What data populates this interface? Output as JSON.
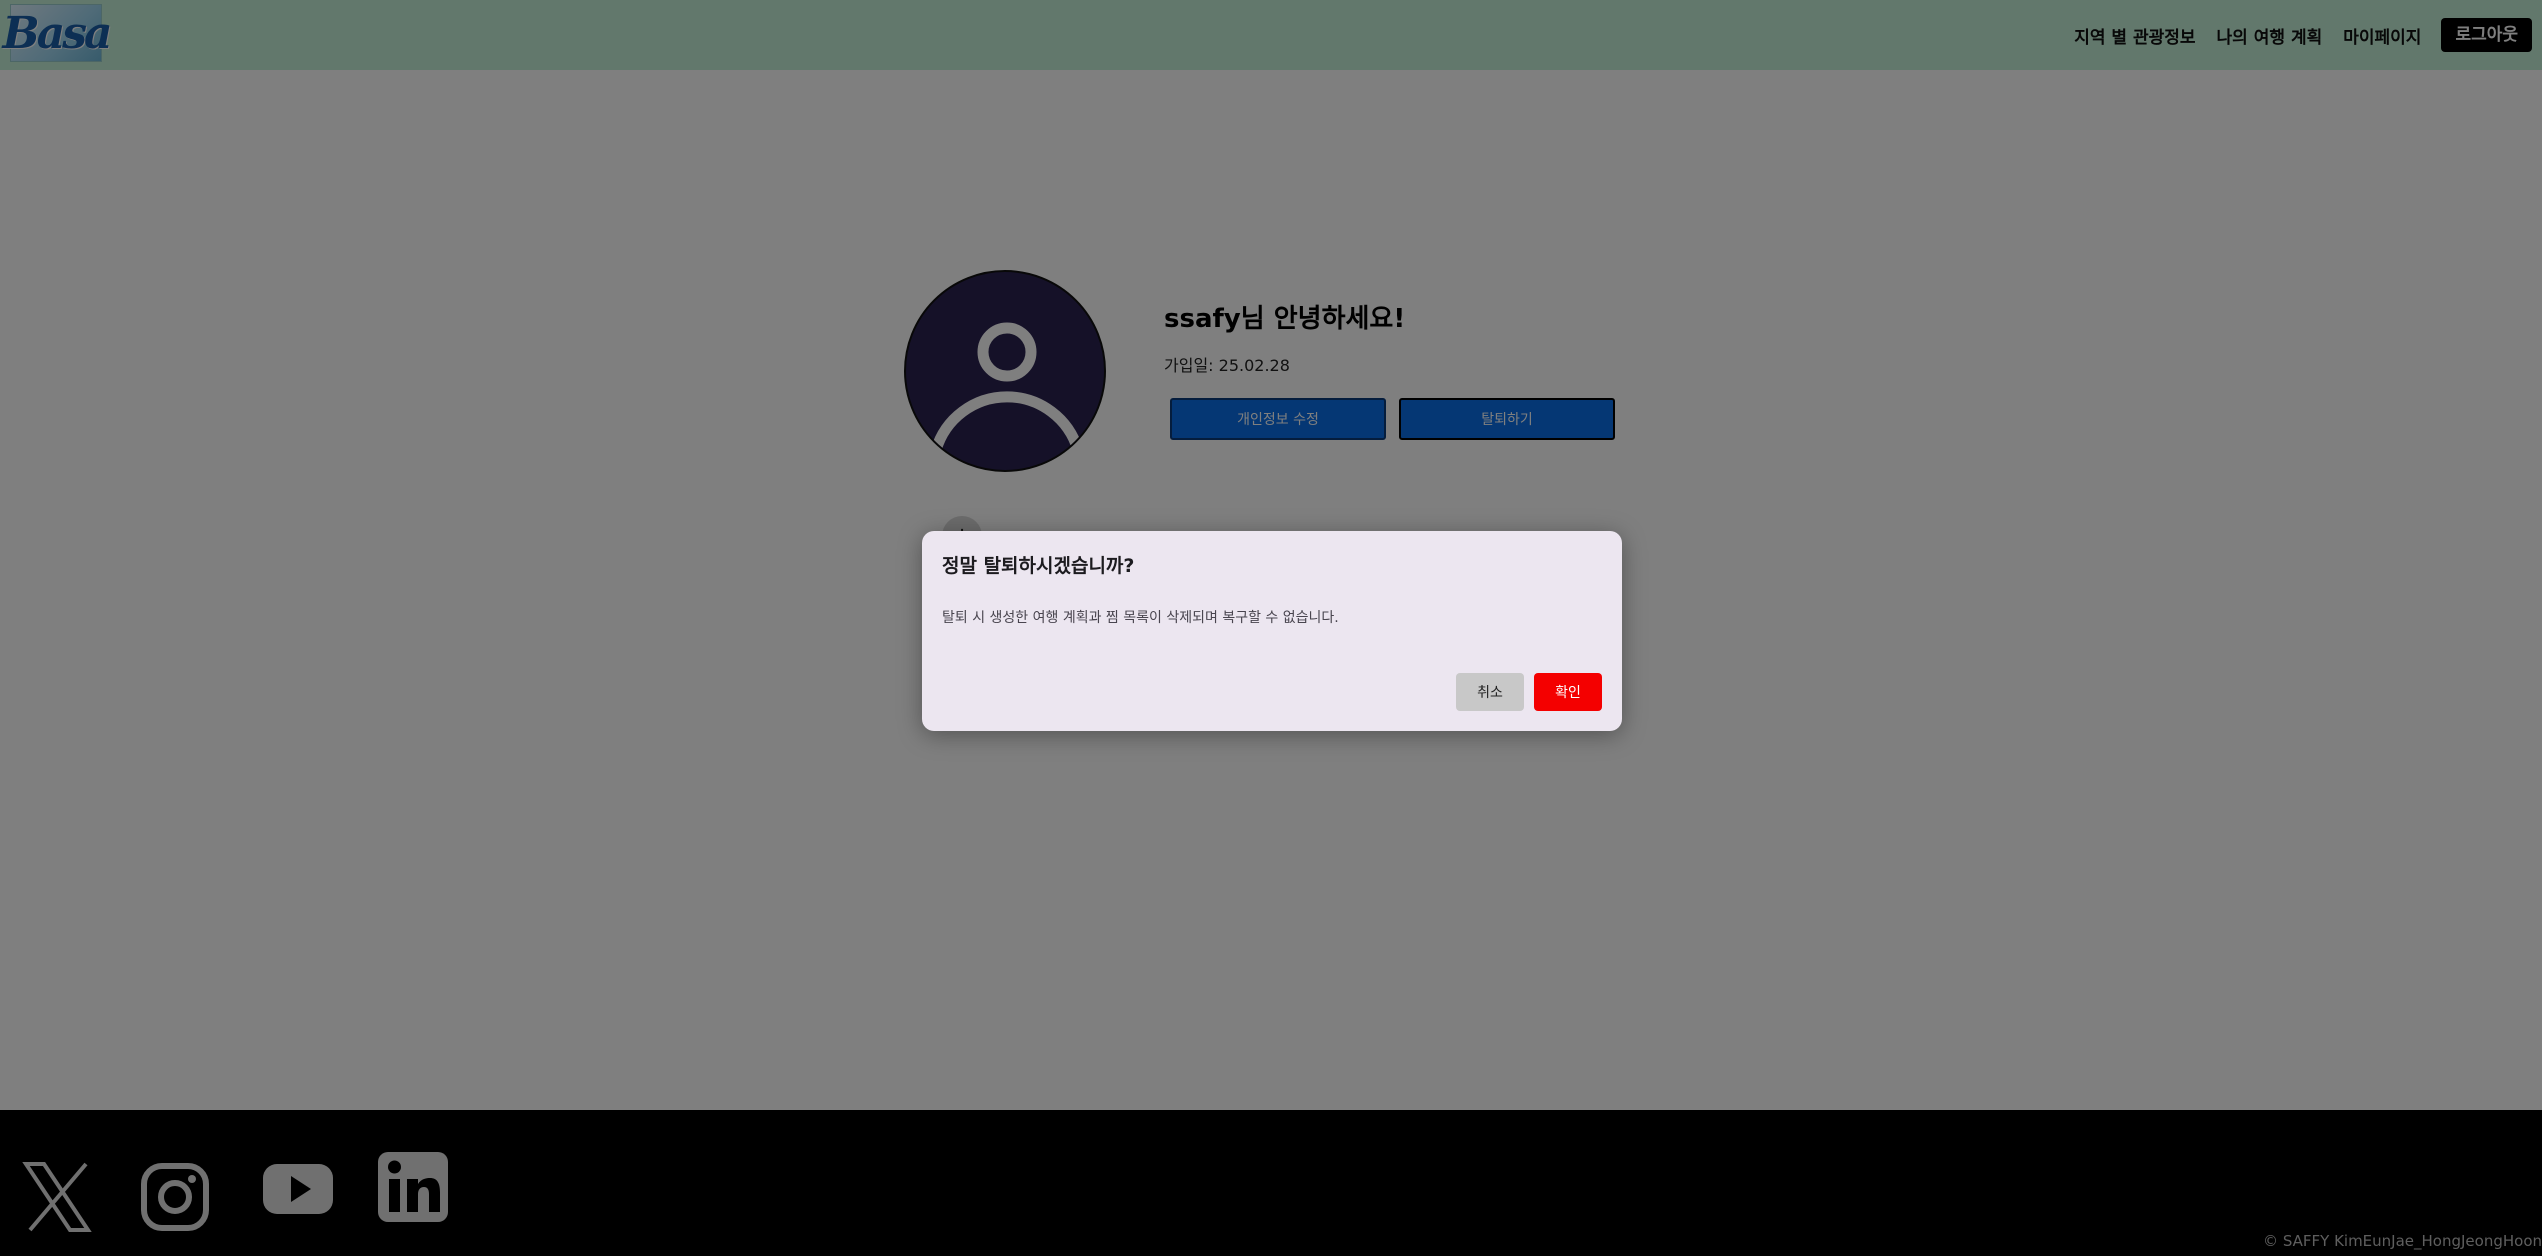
{
  "header": {
    "logo_text": "Basa",
    "nav": [
      {
        "label": "지역 별 관광정보"
      },
      {
        "label": "나의 여행 계획"
      },
      {
        "label": "마이페이지"
      }
    ],
    "logout_label": "로그아웃"
  },
  "profile": {
    "greeting": "ssafy님 안녕하세요!",
    "joined": "가입일: 25.02.28",
    "edit_button": "개인정보 수정",
    "withdraw_button": "탈퇴하기",
    "avatar_icon": "user-avatar-icon"
  },
  "footer": {
    "social_icons": [
      "x-icon",
      "instagram-icon",
      "youtube-icon",
      "linkedin-icon"
    ],
    "copyright": "© SAFFY KimEunJae_HongJeongHoon"
  },
  "modal": {
    "title": "정말 탈퇴하시겠습니까?",
    "body": "탈퇴 시 생성한 여행 계획과 찜 목록이 삭제되며 복구할 수 없습니다.",
    "cancel_label": "취소",
    "confirm_label": "확인"
  },
  "colors": {
    "header_bg": "#c5f0d8",
    "primary_button": "#0a6ee8",
    "confirm_button": "#f40000",
    "modal_bg": "#ece6f0",
    "overlay": "rgba(0,0,0,0.5)"
  }
}
